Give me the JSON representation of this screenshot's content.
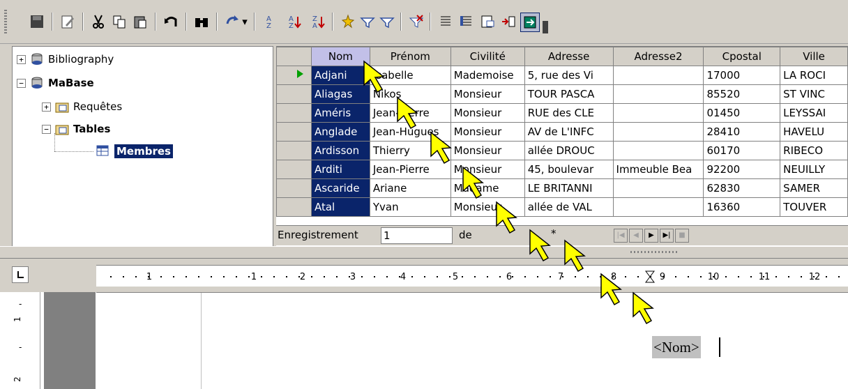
{
  "tree": {
    "items": [
      {
        "label": "Bibliography",
        "expander": "+",
        "bold": false
      },
      {
        "label": "MaBase",
        "expander": "−",
        "bold": true
      },
      {
        "label": "Requêtes",
        "expander": "+",
        "bold": false
      },
      {
        "label": "Tables",
        "expander": "−",
        "bold": true
      },
      {
        "label": "Membres",
        "expander": "",
        "bold": true
      }
    ]
  },
  "grid": {
    "columns": [
      "Nom",
      "Prénom",
      "Civilité",
      "Adresse",
      "Adresse2",
      "Cpostal",
      "Ville"
    ],
    "rows": [
      [
        "Adjani",
        "Isabelle",
        "Mademoise",
        "5, rue des Vi",
        "",
        "17000",
        "LA ROCI"
      ],
      [
        "Aliagas",
        "Nikos",
        "Monsieur",
        "TOUR PASCA",
        "",
        "85520",
        "ST VINC"
      ],
      [
        "Améris",
        "Jean-Pierre",
        "Monsieur",
        "RUE des CLE",
        "",
        "01450",
        "LEYSSAI"
      ],
      [
        "Anglade",
        "Jean-Hugues",
        "Monsieur",
        "AV de L'INFC",
        "",
        "28410",
        "HAVELU"
      ],
      [
        "Ardisson",
        "Thierry",
        "Monsieur",
        "allée DROUC",
        "",
        "60170",
        "RIBECO"
      ],
      [
        "Arditi",
        "Jean-Pierre",
        "Monsieur",
        "45, boulevar",
        "Immeuble Bea",
        "92200",
        "NEUILLY"
      ],
      [
        "Ascaride",
        "Ariane",
        "Madame",
        "LE BRITANNI",
        "",
        "62830",
        "SAMER"
      ],
      [
        "Atal",
        "Yvan",
        "Monsieur",
        "allée de VAL",
        "",
        "16360",
        "TOUVER"
      ]
    ]
  },
  "navbar": {
    "label": "Enregistrement",
    "record": "1",
    "of_label": "de",
    "total": "*"
  },
  "ruler": {
    "labels": [
      "1",
      "1",
      "2",
      "3",
      "4",
      "5",
      "6",
      "7",
      "8",
      "9",
      "10",
      "11",
      "12"
    ]
  },
  "vruler": {
    "labels": [
      "1",
      "2"
    ]
  },
  "document": {
    "field": "<Nom>"
  },
  "colors": {
    "selection": "#0a246a",
    "face": "#d4d0c8",
    "pointer": "#ffff00"
  }
}
